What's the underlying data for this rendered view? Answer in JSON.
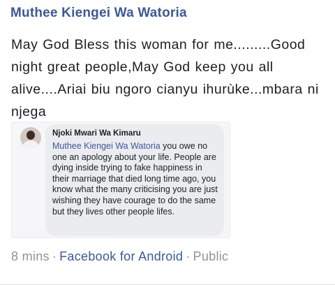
{
  "post": {
    "author": "Muthee Kiengei Wa Watoria",
    "text": "May God Bless this woman for me.........Good night great people,May  God keep you all alive....Ariai biu ngoro cianyu ihurùke...mbara ni njega"
  },
  "attachment": {
    "avatar_icon": "person-photo",
    "commenter": "Njoki Mwari Wa Kimaru",
    "mention": "Muthee Kiengei Wa Watoria",
    "comment_text": " you owe no one an apology about your life.  People are dying inside trying to fake happiness in their marriage that died long time ago, you know what the many criticising you are just wishing they have courage to do the same but they lives other people lifes."
  },
  "meta": {
    "time": "8 mins",
    "separator": "·",
    "app": "Facebook for Android",
    "privacy": "Public"
  },
  "colors": {
    "link_blue": "#3b5998",
    "muted_gray": "#8d949e",
    "bubble_bg": "#ebecf0"
  }
}
